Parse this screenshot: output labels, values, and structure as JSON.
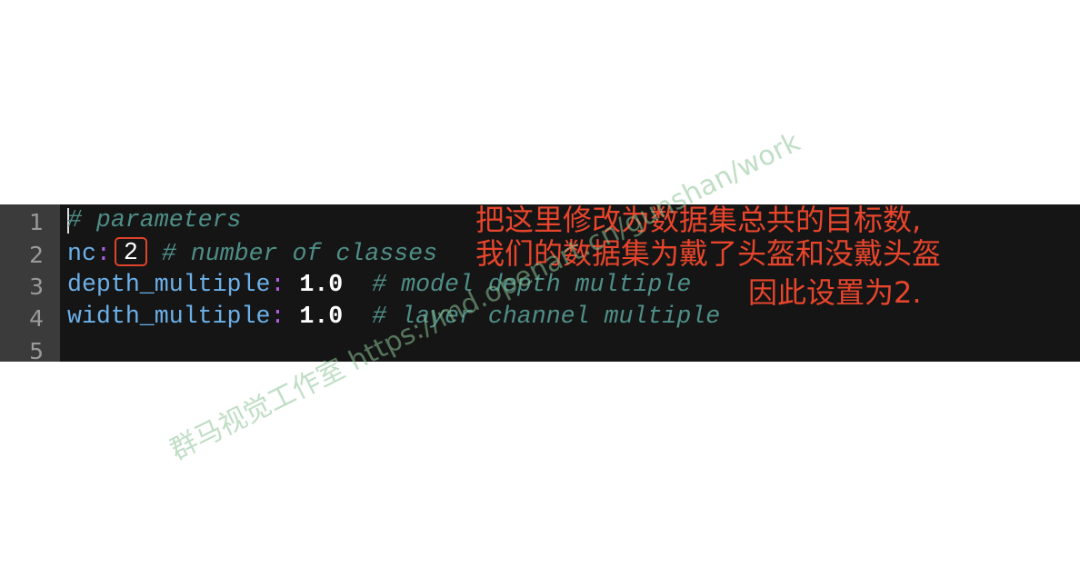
{
  "editor": {
    "line_numbers": [
      "1",
      "2",
      "3",
      "4",
      "5"
    ],
    "lines": [
      {
        "comment": "# parameters"
      },
      {
        "key": "nc",
        "colon": ":",
        "value": "2",
        "comment": "# number of classes"
      },
      {
        "key": "depth_multiple",
        "colon": ":",
        "value": "1.0",
        "comment": "# model depth multiple"
      },
      {
        "key": "width_multiple",
        "colon": ":",
        "value": "1.0",
        "comment": "# layer channel multiple"
      },
      {}
    ]
  },
  "annotation": {
    "color": "#e8452c",
    "lines": [
      "把这里修改为数据集总共的目标数,",
      "我们的数据集为戴了头盔和没戴头盔",
      "因此设置为2."
    ]
  },
  "watermark": "群马视觉工作室 https://md.openart.cn/gunshan/work"
}
